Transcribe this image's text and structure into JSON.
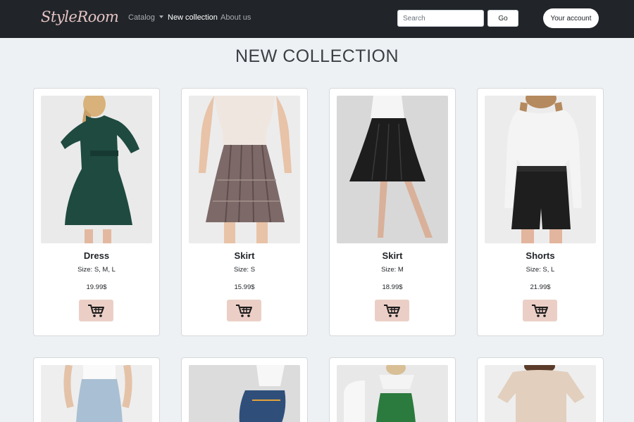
{
  "header": {
    "brand": "StyleRoom",
    "nav": [
      {
        "label": "Catalog",
        "dropdown": true
      },
      {
        "label": "New collection",
        "active": true
      },
      {
        "label": "About us"
      }
    ],
    "search": {
      "placeholder": "Search",
      "value": ""
    },
    "go_label": "Go",
    "account_label": "Your account"
  },
  "main": {
    "title": "NEW COLLECTION",
    "products": [
      {
        "name": "Dress",
        "size": "Size: S, M, L",
        "price": "19.99$",
        "icon": "cart-icon"
      },
      {
        "name": "Skirt",
        "size": "Size: S",
        "price": "15.99$",
        "icon": "cart-icon"
      },
      {
        "name": "Skirt",
        "size": "Size: M",
        "price": "18.99$",
        "icon": "cart-icon"
      },
      {
        "name": "Shorts",
        "size": "Size: S, L",
        "price": "21.99$",
        "icon": "cart-icon"
      }
    ]
  },
  "colors": {
    "navbar": "#212529",
    "brand": "#e6c4c4",
    "page_background": "#eef1f4",
    "cart_button": "#ebcfc6"
  }
}
